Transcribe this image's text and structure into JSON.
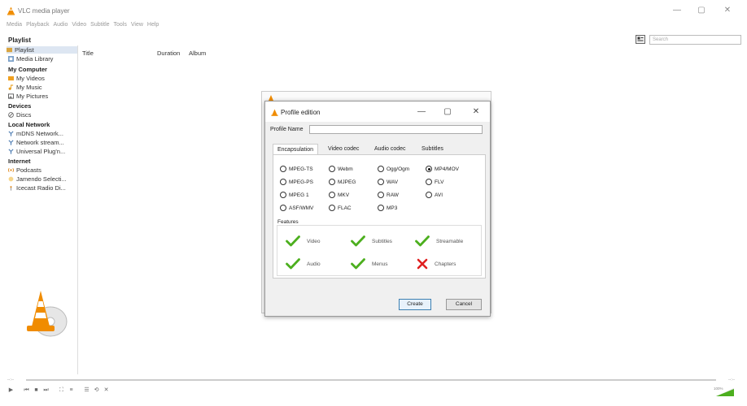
{
  "window": {
    "title": "VLC media player",
    "controls": {
      "minimize": "—",
      "maximize": "▢",
      "close": "✕"
    }
  },
  "menu": [
    "Media",
    "Playback",
    "Audio",
    "Video",
    "Subtitle",
    "Tools",
    "View",
    "Help"
  ],
  "playlist_header": "Playlist",
  "search": {
    "placeholder": "Search"
  },
  "sidebar": {
    "playlist": "Playlist",
    "media_library": "Media Library",
    "my_computer_header": "My Computer",
    "my_videos": "My Videos",
    "my_music": "My Music",
    "my_pictures": "My Pictures",
    "devices_header": "Devices",
    "discs": "Discs",
    "local_network_header": "Local Network",
    "mdns": "mDNS Network...",
    "network_streams": "Network stream...",
    "upnp": "Universal Plug'n...",
    "internet_header": "Internet",
    "podcasts": "Podcasts",
    "jamendo": "Jamendo Selecti...",
    "icecast": "Icecast Radio Di..."
  },
  "columns": {
    "title": "Title",
    "duration": "Duration",
    "album": "Album"
  },
  "dialog": {
    "title": "Profile edition",
    "profile_name_label": "Profile Name",
    "profile_name_value": "",
    "tabs": [
      "Encapsulation",
      "Video codec",
      "Audio codec",
      "Subtitles"
    ],
    "active_tab": "Encapsulation",
    "options": {
      "mpeg_ts": "MPEG-TS",
      "webm": "Webm",
      "ogg": "Ogg/Ogm",
      "mp4": "MP4/MOV",
      "mpeg_ps": "MPEG-PS",
      "mjpeg": "MJPEG",
      "wav": "WAV",
      "flv": "FLV",
      "mpeg1": "MPEG 1",
      "mkv": "MKV",
      "raw": "RAW",
      "avi": "AVI",
      "asf": "ASF/WMV",
      "flac": "FLAC",
      "mp3": "MP3"
    },
    "selected_option": "MP4/MOV",
    "features_label": "Features",
    "features": {
      "video": "Video",
      "subtitles": "Subtitles",
      "streamable": "Streamable",
      "audio": "Audio",
      "menus": "Menus",
      "chapters": "Chapters"
    },
    "feature_support": {
      "video": true,
      "subtitles": true,
      "streamable": true,
      "audio": true,
      "menus": true,
      "chapters": false
    },
    "create_button": "Create",
    "cancel_button": "Cancel"
  },
  "player": {
    "time_elapsed": "--:--",
    "time_total": "--:--",
    "volume": "100%"
  },
  "colors": {
    "check": "#4caf1e",
    "cross": "#e02020",
    "cone": "#f08c00",
    "selection": "#dde6f2",
    "primary_border": "#3c7fb1"
  }
}
